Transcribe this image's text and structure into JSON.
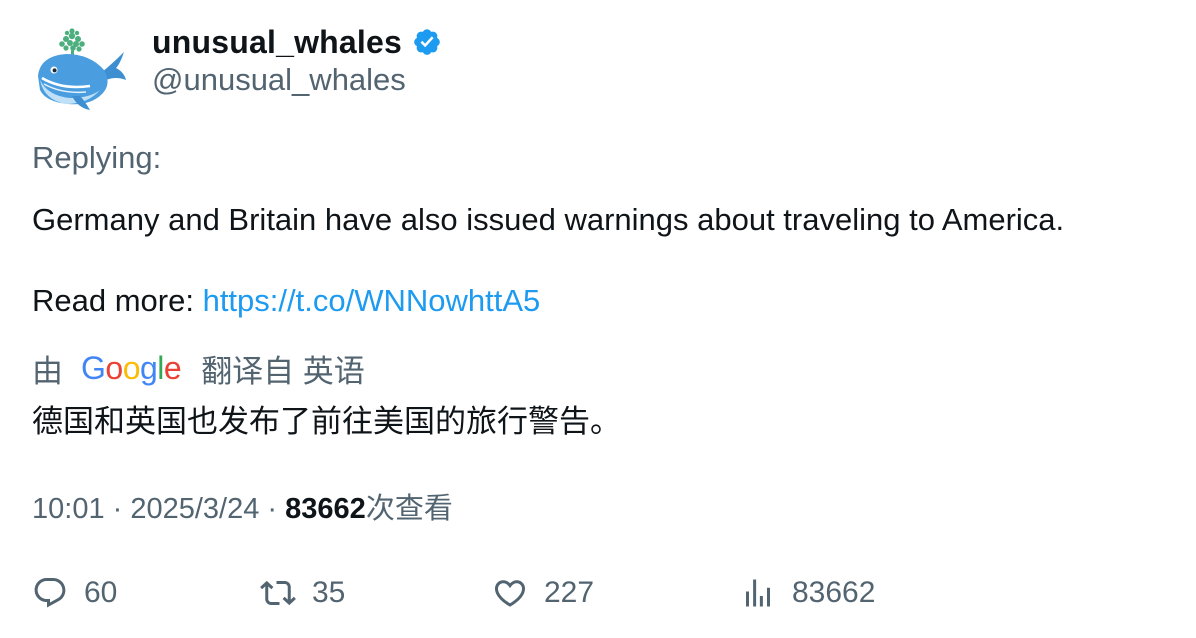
{
  "author": {
    "display_name": "unusual_whales",
    "handle": "@unusual_whales",
    "verified": true,
    "avatar_icon": "whale-icon",
    "verified_color": "#1d9bf0"
  },
  "tweet": {
    "replying_label": "Replying:",
    "text": "Germany and Britain have also issued warnings about traveling to America.",
    "read_more_label": "Read more: ",
    "link": "https://t.co/WNNowhttA5",
    "link_color": "#1d9bf0"
  },
  "translation": {
    "by_label": "由",
    "provider": "Google",
    "from_label": "翻译自 英语",
    "text": "德国和英国也发布了前往美国的旅行警告。"
  },
  "meta": {
    "time": "10:01",
    "separator": " · ",
    "date": "2025/3/24",
    "views_count": "83662",
    "views_label": "次查看"
  },
  "actions": {
    "reply": {
      "icon": "reply-icon",
      "count": "60"
    },
    "retweet": {
      "icon": "retweet-icon",
      "count": "35"
    },
    "like": {
      "icon": "heart-icon",
      "count": "227"
    },
    "views": {
      "icon": "views-chart-icon",
      "count": "83662"
    }
  }
}
